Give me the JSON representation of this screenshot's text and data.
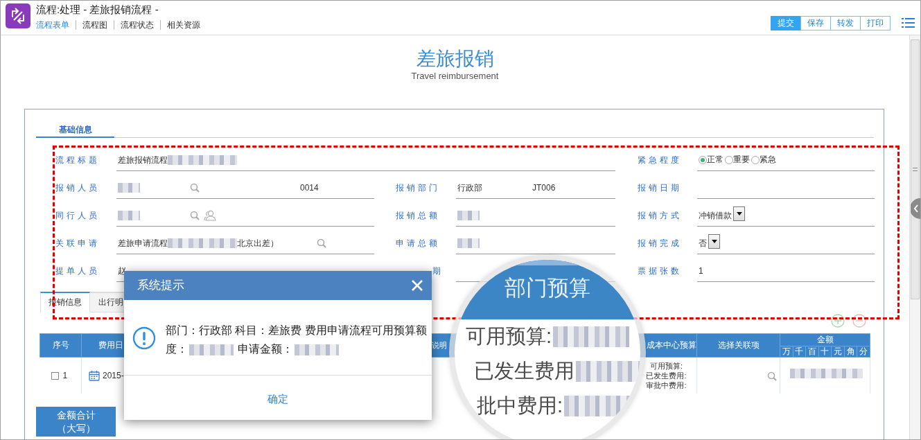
{
  "window": {
    "title": "流程:处理 - 差旅报销流程 -"
  },
  "tabs": [
    {
      "label": "流程表单",
      "selected": true
    },
    {
      "label": "流程图",
      "selected": false
    },
    {
      "label": "流程状态",
      "selected": false
    },
    {
      "label": "相关资源",
      "selected": false
    }
  ],
  "toolbar": [
    {
      "label": "提交",
      "selected": true
    },
    {
      "label": "保存",
      "selected": false
    },
    {
      "label": "转发",
      "selected": false
    },
    {
      "label": "打印",
      "selected": false
    }
  ],
  "form": {
    "title": "差旅报销",
    "subtitle": "Travel reimbursement",
    "section": "基础信息",
    "rows": [
      {
        "fields": [
          {
            "label": "流程标题",
            "kind": "plain",
            "parts": [
              {
                "kind": "text",
                "text": "差旅报销流程"
              },
              {
                "kind": "redacted"
              }
            ]
          },
          {
            "label": "紧急程度",
            "kind": "radio",
            "options": [
              {
                "label": "正常",
                "selected": true
              },
              {
                "label": "重要",
                "selected": false
              },
              {
                "label": "紧急",
                "selected": false
              }
            ]
          }
        ]
      },
      {
        "fields": [
          {
            "label": "报销人员",
            "kind": "plain",
            "parts": [
              {
                "kind": "redacted"
              },
              {
                "kind": "lookup"
              },
              {
                "kind": "text",
                "text": "0014"
              }
            ]
          },
          {
            "label": "报销部门",
            "kind": "plain",
            "parts": [
              {
                "kind": "text",
                "text": "行政部"
              },
              {
                "kind": "text",
                "text": "JT006"
              }
            ]
          },
          {
            "label": "报销日期",
            "kind": "plain"
          }
        ]
      },
      {
        "fields": [
          {
            "label": "同行人员",
            "kind": "plain",
            "parts": [
              {
                "kind": "redacted"
              },
              {
                "kind": "lookup"
              },
              {
                "kind": "picker"
              }
            ]
          },
          {
            "label": "报销总额",
            "kind": "plain",
            "parts": [
              {
                "kind": "redacted"
              }
            ]
          },
          {
            "label": "报销方式",
            "kind": "select",
            "value": "冲销借款"
          }
        ]
      },
      {
        "fields": [
          {
            "label": "关联申请",
            "kind": "plain",
            "parts": [
              {
                "kind": "text",
                "text": "差旅申请流程"
              },
              {
                "kind": "redacted"
              },
              {
                "kind": "text",
                "text": "北京出差）"
              },
              {
                "kind": "lookup"
              }
            ]
          },
          {
            "label": "申请总额",
            "kind": "plain",
            "parts": [
              {
                "kind": "redacted"
              }
            ]
          },
          {
            "label": "报销完成",
            "kind": "select",
            "value": "否"
          }
        ]
      },
      {
        "fields": [
          {
            "label": "提单人员",
            "kind": "plain",
            "parts": [
              {
                "kind": "text",
                "text": "赵"
              }
            ]
          },
          {
            "label": "期",
            "kind": "plain",
            "cut_left": true
          },
          {
            "label": "票据张数",
            "kind": "plain",
            "parts": [
              {
                "kind": "text",
                "text": "1"
              }
            ]
          }
        ]
      }
    ]
  },
  "detail_tabs": [
    {
      "label": "报销信息",
      "selected": true
    },
    {
      "label": "出行明",
      "selected": false
    }
  ],
  "detail": {
    "columns": [
      {
        "label": "序号"
      },
      {
        "label": "费用日"
      },
      {
        "label": "说明"
      },
      {
        "label": "成本中心预算"
      },
      {
        "label": "选择关联项"
      },
      {
        "label": "金额",
        "sub": [
          "万",
          "千",
          "百",
          "十",
          "元",
          "角",
          "分"
        ]
      }
    ],
    "rows": [
      {
        "checked": false,
        "index": "1",
        "date": "2015-",
        "budget_lines": [
          "可用预算:",
          "已发生费用:",
          "审批中费用:"
        ],
        "amount_redacted": true
      }
    ]
  },
  "total": {
    "label_lines": [
      "金额合计",
      "（大写）"
    ]
  },
  "dialog": {
    "title": "系统提示",
    "message": [
      {
        "kind": "text",
        "text": "部门：行政部 科目：差旅费 费用申请流程可用预算额度："
      },
      {
        "kind": "redacted"
      },
      {
        "kind": "text",
        "text": " 申请金额："
      },
      {
        "kind": "redacted"
      }
    ],
    "button": "确定"
  },
  "magnifier": {
    "title": "部门预算",
    "lines": [
      {
        "label": "可用预算:",
        "redacted": true
      },
      {
        "label": "已发生费用",
        "redacted": true
      },
      {
        "label": "批中费用:",
        "redacted": true
      }
    ]
  }
}
